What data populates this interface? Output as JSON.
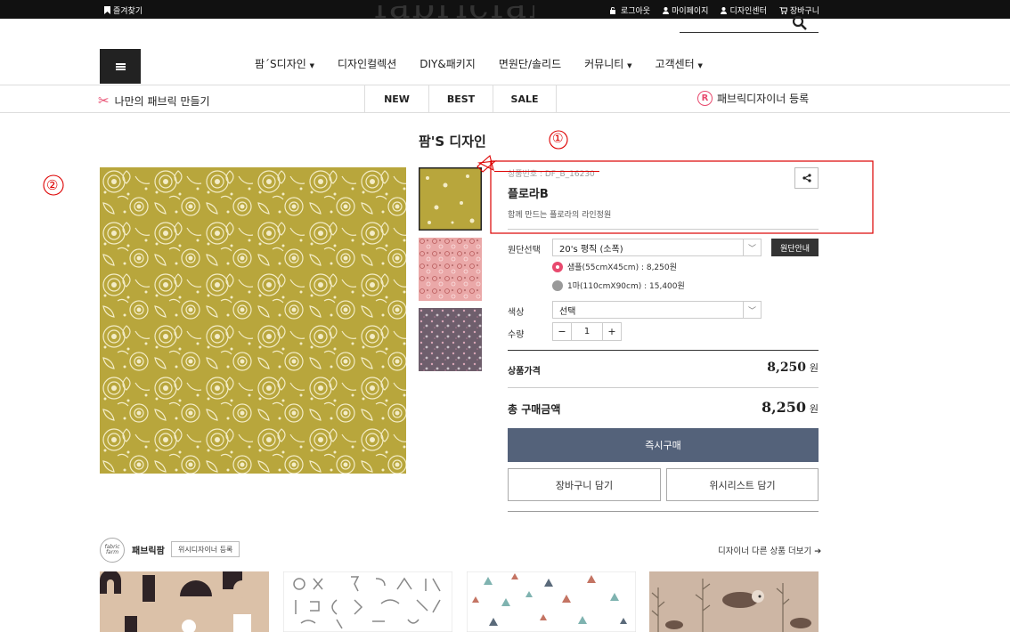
{
  "topbar": {
    "favorites": "즐겨찾기",
    "links": [
      "로그아웃",
      "마이페이지",
      "디자인센터",
      "장바구니"
    ]
  },
  "header": {
    "logo": "fabricfarm",
    "nav": [
      "팜´S디자인",
      "디자인컬렉션",
      "DIY&패키지",
      "면원단/솔리드",
      "커뮤니티",
      "고객센터"
    ],
    "nav_has_dropdown": [
      true,
      false,
      false,
      false,
      true,
      true
    ]
  },
  "subbar": {
    "make_fabric": "나만의 패브릭 만들기",
    "tabs": [
      "NEW",
      "BEST",
      "SALE"
    ],
    "register": "패브릭디자이너 등록",
    "register_icon": "R"
  },
  "page_title": "팜'S 디자인",
  "product": {
    "code": "상품번호 : DF_B_16230",
    "name": "플로라B",
    "subtitle": "함께 만드는 플로라의 라인정원",
    "fabric_label": "원단선택",
    "fabric_value": "20's 평직 (소폭)",
    "fabric_guide": "원단안내",
    "size_options": [
      "샘플(55cmX45cm) : 8,250원",
      "1마(110cmX90cm) : 15,400원"
    ],
    "selected_size": 0,
    "color_label": "색상",
    "color_value": "선택",
    "qty_label": "수량",
    "qty_minus": "−",
    "qty": "1",
    "qty_plus": "+",
    "price_label": "상품가격",
    "price": "8,250",
    "won": "원",
    "total_label": "총 구매금액",
    "total": "8,250",
    "buy_now": "즉시구매",
    "add_cart": "장바구니 담기",
    "add_wishlist": "위시리스트 담기"
  },
  "designer": {
    "logo_text": "fabric farm",
    "name": "패브릭팜",
    "wish_button": "위시디자이너 등록",
    "more_link": "디자이너 다른 상품 더보기 ➔"
  },
  "annotations": [
    "①",
    "②"
  ],
  "colors": {
    "pattern_main": "#b8a63c",
    "pink": "#e84a6e",
    "buy_button": "#54627a",
    "annotation_red": "#dd0000"
  }
}
